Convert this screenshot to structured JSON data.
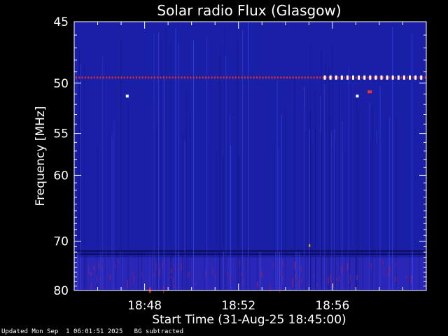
{
  "chart_data": {
    "type": "heatmap",
    "title": "Solar radio Flux (Glasgow)",
    "xlabel": "Start Time (31-Aug-25 18:45:00)",
    "ylabel": "Frequency [MHz]",
    "x_ticks": [
      "18:48",
      "18:52",
      "18:56"
    ],
    "x_tick_minutes": [
      3,
      7,
      11
    ],
    "x_range_minutes": [
      0,
      15
    ],
    "y_ticks": [
      45,
      50,
      55,
      60,
      70,
      80
    ],
    "y_range": [
      80,
      45
    ],
    "y_scale": "reciprocal",
    "colors": {
      "background_band": "#1a1fa8",
      "low_band": "#2a26b8",
      "interference_line": "#ff3020",
      "bright_spot": "#ffffff"
    },
    "features": [
      {
        "kind": "interference-line",
        "frequency_mhz": 49.5,
        "from_minute": 0,
        "to_minute": 15
      },
      {
        "kind": "bright-dots",
        "frequency_mhz": 49.5,
        "from_minute": 10.6,
        "to_minute": 15
      }
    ]
  },
  "footer": {
    "updated": "Updated Mon Sep  1 06:01:51 2025",
    "note": "BG subtracted"
  }
}
